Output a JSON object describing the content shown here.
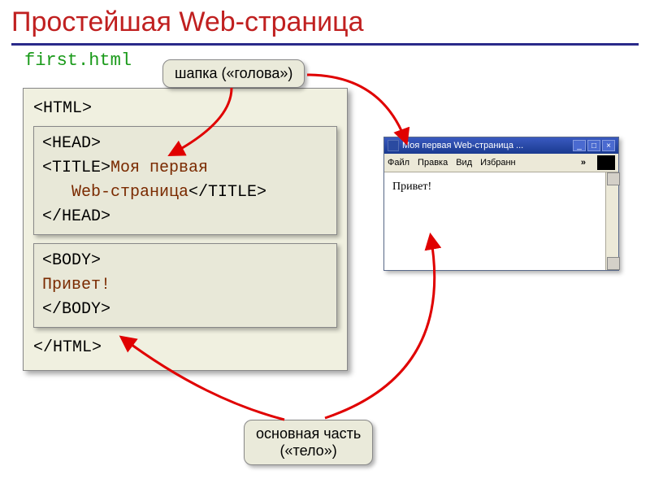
{
  "slide": {
    "title": "Простейшая Web-страница",
    "filename": "first.html"
  },
  "code": {
    "html_open": "<HTML>",
    "html_close": "</HTML>",
    "head_open": "<HEAD>",
    "head_close": "</HEAD>",
    "title_open": "<TITLE>",
    "title_close": "</TITLE>",
    "title_text_1": "Моя первая",
    "title_text_2": "Web-страница",
    "body_open": "<BODY>",
    "body_close": "</BODY>",
    "body_text": "Привет!"
  },
  "callouts": {
    "head": "шапка («голова»)",
    "body_l1": "основная часть",
    "body_l2": "(«тело»)"
  },
  "browser": {
    "title": "Моя первая Web-страница ...",
    "menu": {
      "file": "Файл",
      "edit": "Правка",
      "view": "Вид",
      "fav": "Избранн"
    },
    "chevron": "»",
    "content": "Привет!"
  }
}
